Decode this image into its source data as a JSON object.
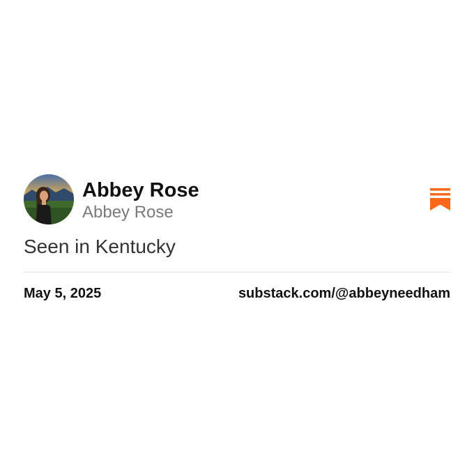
{
  "author": {
    "display_name": "Abbey Rose",
    "handle": "Abbey Rose"
  },
  "post": {
    "text": "Seen in Kentucky"
  },
  "footer": {
    "date": "May 5, 2025",
    "source": "substack.com/@abbeyneedham"
  },
  "icons": {
    "logo": "substack-logo-icon",
    "avatar": "profile-photo"
  },
  "colors": {
    "brand": "#FF6719",
    "name_text": "#111111",
    "handle_text": "#7A7A7A",
    "divider": "#E4E4E4"
  }
}
